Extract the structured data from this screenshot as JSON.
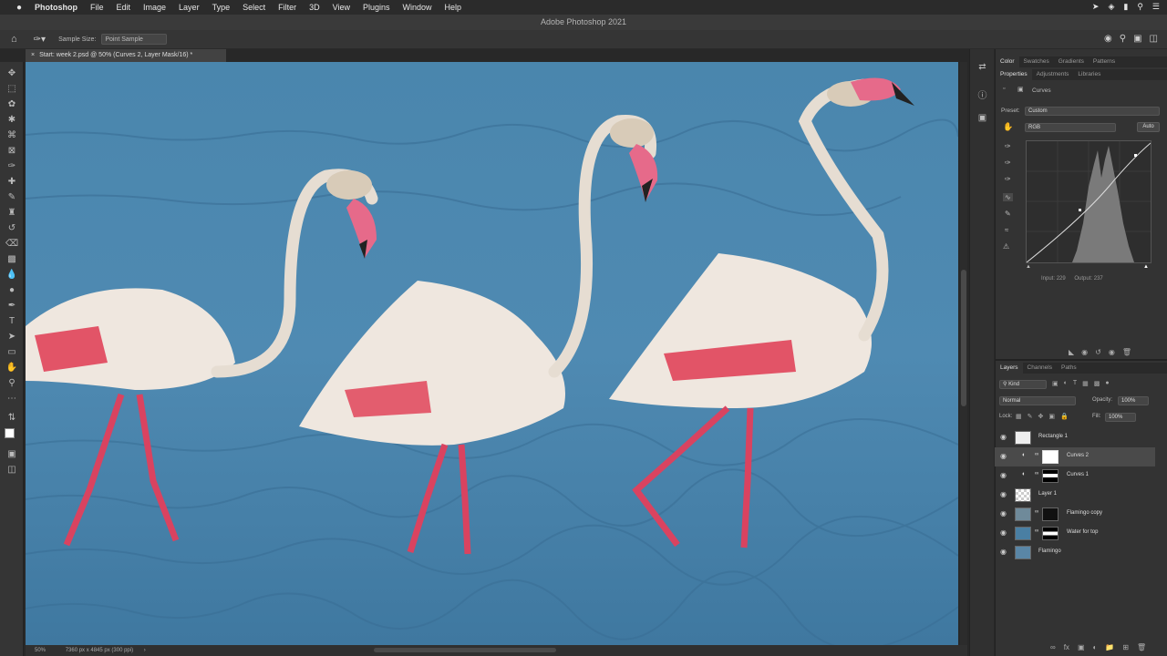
{
  "menubar": {
    "apple": "",
    "items": [
      "Photoshop",
      "File",
      "Edit",
      "Image",
      "Layer",
      "Type",
      "Select",
      "Filter",
      "3D",
      "View",
      "Plugins",
      "Window",
      "Help"
    ]
  },
  "window_title": "Adobe Photoshop 2021",
  "options": {
    "sample_size_label": "Sample Size:",
    "sample_size_value": "Point Sample"
  },
  "document_tab": "Start: week 2.psd @ 50% (Curves 2, Layer Mask/16) *",
  "statusbar": {
    "zoom": "50%",
    "doc_info": "7360 px x 4845 px (300 ppi)"
  },
  "top_panel": {
    "tabs": [
      "Color",
      "Swatches",
      "Gradients",
      "Patterns"
    ],
    "active": "Color"
  },
  "properties_panel": {
    "tabs": [
      "Properties",
      "Adjustments",
      "Libraries"
    ],
    "title": "Curves",
    "preset_label": "Preset:",
    "preset_value": "Custom",
    "channel_value": "RGB",
    "auto_label": "Auto",
    "input_label": "Input:",
    "input_value": "229",
    "output_label": "Output:",
    "output_value": "237"
  },
  "layers_panel": {
    "tabs": [
      "Layers",
      "Channels",
      "Paths"
    ],
    "filter_value": "Kind",
    "blend_mode": "Normal",
    "opacity_label": "Opacity:",
    "opacity_value": "100%",
    "lock_label": "Lock:",
    "fill_label": "Fill:",
    "fill_value": "100%",
    "layers": [
      {
        "name": "Rectangle 1"
      },
      {
        "name": "Curves 2"
      },
      {
        "name": "Curves 1"
      },
      {
        "name": "Layer 1"
      },
      {
        "name": "Flamingo copy"
      },
      {
        "name": "Water for top"
      },
      {
        "name": "Flamingo"
      }
    ]
  },
  "colors": {
    "water": "#4a86ad",
    "flamingo_body": "#efe7df",
    "flamingo_pink": "#e0445a",
    "legs": "#d94360"
  }
}
